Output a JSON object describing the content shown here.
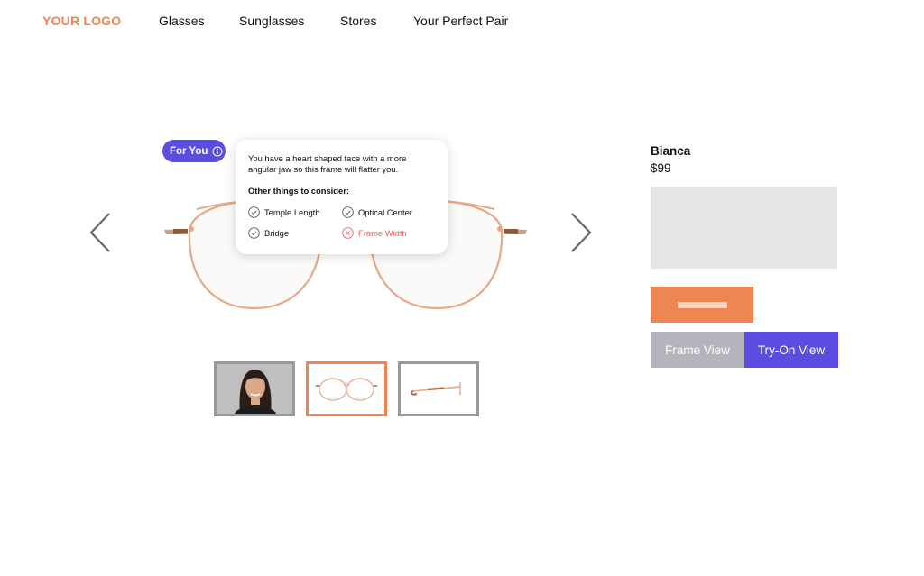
{
  "header": {
    "logo": "YOUR LOGO",
    "nav": [
      "Glasses",
      "Sunglasses",
      "Stores",
      "Your Perfect Pair"
    ]
  },
  "icons": {
    "prev": "chevron-left-icon",
    "next": "chevron-right-icon",
    "info": "info-icon",
    "check": "check-circle-icon",
    "cross": "x-circle-icon"
  },
  "badge": {
    "label": "For You"
  },
  "tooltip": {
    "message": "You have a heart shaped face with a more angular jaw so this frame will flatter you.",
    "heading": "Other things to consider:",
    "items": [
      {
        "label": "Temple Length",
        "status": "good"
      },
      {
        "label": "Optical Center",
        "status": "good"
      },
      {
        "label": "Bridge",
        "status": "good"
      },
      {
        "label": "Frame Width",
        "status": "bad"
      }
    ]
  },
  "thumbnails": [
    {
      "name": "model-photo",
      "selected": false
    },
    {
      "name": "front-view",
      "selected": true
    },
    {
      "name": "side-view",
      "selected": false
    }
  ],
  "product": {
    "name": "Bianca",
    "price": "$99"
  },
  "views": {
    "frame_label": "Frame View",
    "tryon_label": "Try-On View"
  },
  "colors": {
    "brand": "#ee8552",
    "accent": "#5a4de0",
    "error": "#ee5d5d",
    "placeholder": "#e6e6e6",
    "inactive": "#b4b4bc"
  }
}
